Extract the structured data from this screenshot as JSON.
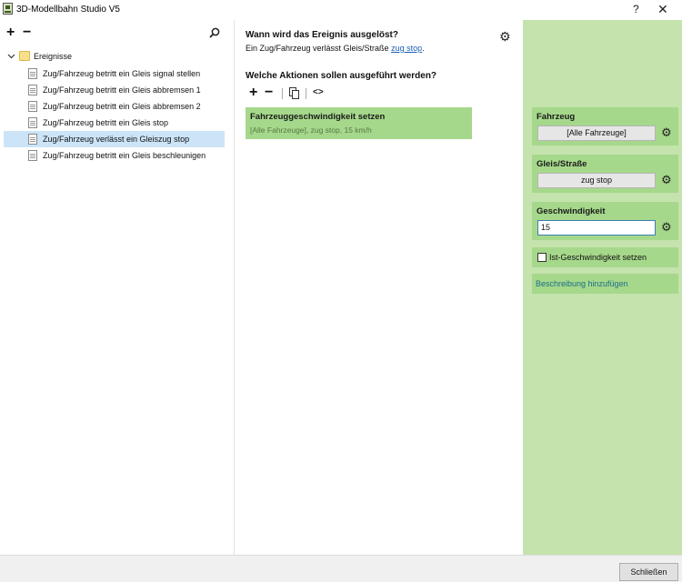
{
  "window": {
    "title": "3D-Modellbahn Studio V5",
    "help_label": "?",
    "close_label": "✕"
  },
  "left_panel": {
    "add_label": "+",
    "remove_label": "−",
    "root": {
      "label": "Ereignisse",
      "expanded": true
    },
    "items": [
      {
        "label": "Zug/Fahrzeug betritt ein Gleis signal stellen",
        "selected": false
      },
      {
        "label": "Zug/Fahrzeug betritt ein Gleis abbremsen 1",
        "selected": false
      },
      {
        "label": "Zug/Fahrzeug betritt ein Gleis abbremsen 2",
        "selected": false
      },
      {
        "label": "Zug/Fahrzeug betritt ein Gleis stop",
        "selected": false
      },
      {
        "label": "Zug/Fahrzeug verlässt ein Gleiszug stop",
        "selected": true
      },
      {
        "label": "Zug/Fahrzeug betritt ein Gleis beschleunigen",
        "selected": false
      }
    ]
  },
  "middle_panel": {
    "trigger_heading": "Wann wird das Ereignis ausgelöst?",
    "trigger_text": "Ein Zug/Fahrzeug verlässt Gleis/Straße",
    "trigger_link": "zug stop",
    "trigger_period": ".",
    "actions_heading": "Welche Aktionen sollen ausgeführt werden?",
    "toolbar": {
      "add_label": "+",
      "remove_label": "−",
      "code_label": "<>"
    },
    "action": {
      "title": "Fahrzeuggeschwindigkeit setzen",
      "summary": "[Alle Fahrzeuge], zug stop, 15 km/h"
    }
  },
  "right_panel": {
    "vehicle": {
      "title": "Fahrzeug",
      "value": "[Alle Fahrzeuge]"
    },
    "track": {
      "title": "Gleis/Straße",
      "value": "zug stop"
    },
    "speed": {
      "title": "Geschwindigkeit",
      "value": "15"
    },
    "actual_speed": {
      "label": "Ist-Geschwindigkeit setzen",
      "checked": false
    },
    "description_link": "Beschreibung hinzufügen"
  },
  "footer": {
    "close_button": "Schließen"
  },
  "colors": {
    "selection": "#cce4f7",
    "card_green": "#a6d88b",
    "panel_green": "#c4e3ad",
    "link_blue": "#1a5fb4"
  }
}
